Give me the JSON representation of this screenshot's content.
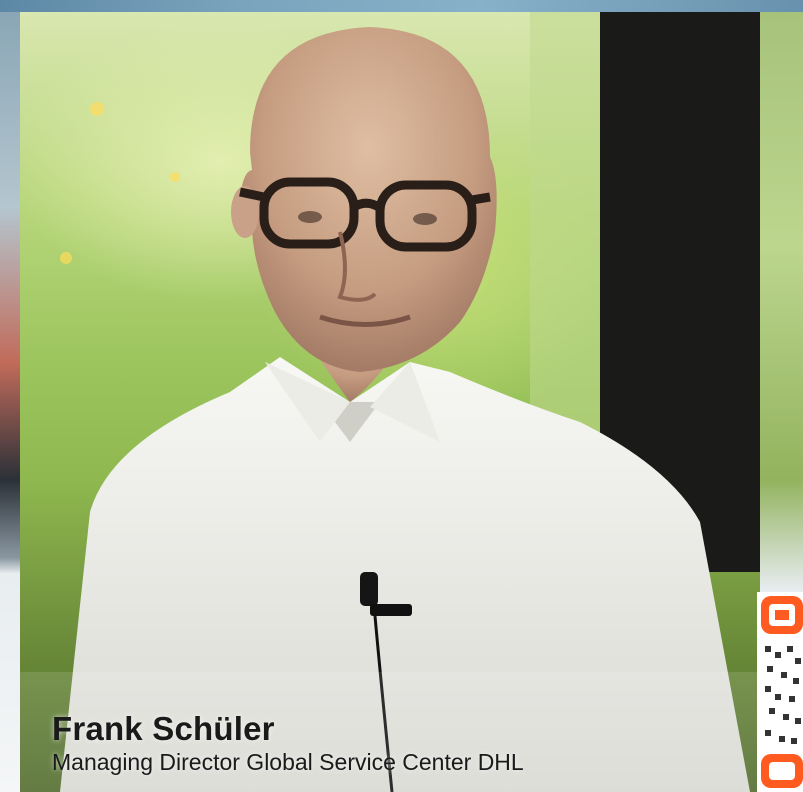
{
  "caption": {
    "name": "Frank Schüler",
    "title": "Managing Director Global Service Center DHL"
  },
  "icons": {
    "qr": "qr-code-icon",
    "microphone": "lapel-microphone-icon"
  },
  "colors": {
    "frame_border": "#6b95b1",
    "qr_accent": "#ff5a1f",
    "caption_text": "#1a1a1a",
    "background_green": "#9cc55e"
  }
}
